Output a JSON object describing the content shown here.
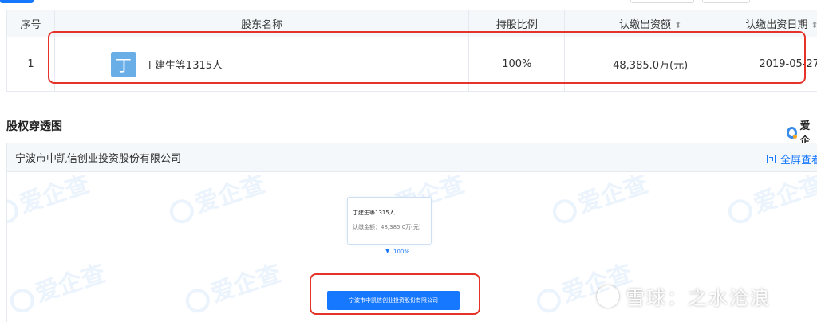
{
  "table": {
    "headers": {
      "index": "序号",
      "name": "股东名称",
      "ratio": "持股比例",
      "amount": "认缴出资额",
      "date": "认缴出资日期"
    },
    "sort_icon": "sort-icon",
    "rows": [
      {
        "index": "1",
        "avatar_char": "丁",
        "name": "丁建生等1315人",
        "ratio": "100%",
        "amount": "48,385.0万(元)",
        "date": "2019-05-27"
      }
    ]
  },
  "section": {
    "title": "股权穿透图",
    "brand": "爱企"
  },
  "panel": {
    "company": "宁波市中凯信创业投资股份有限公司",
    "fullscreen_label": "全屏查看"
  },
  "graph": {
    "top_node_name": "丁建生等1315人",
    "top_node_amount": "认缴金额：48,385.0万(元)",
    "edge_percent": "100%",
    "main_node": "宁波市中凯信创业投资股份有限公司"
  },
  "watermark": {
    "text": "爱企查",
    "xueqiu": "雪球：之水沧浪"
  },
  "colors": {
    "accent": "#1677ff",
    "highlight": "#e5332a",
    "avatar": "#6aaee8"
  }
}
